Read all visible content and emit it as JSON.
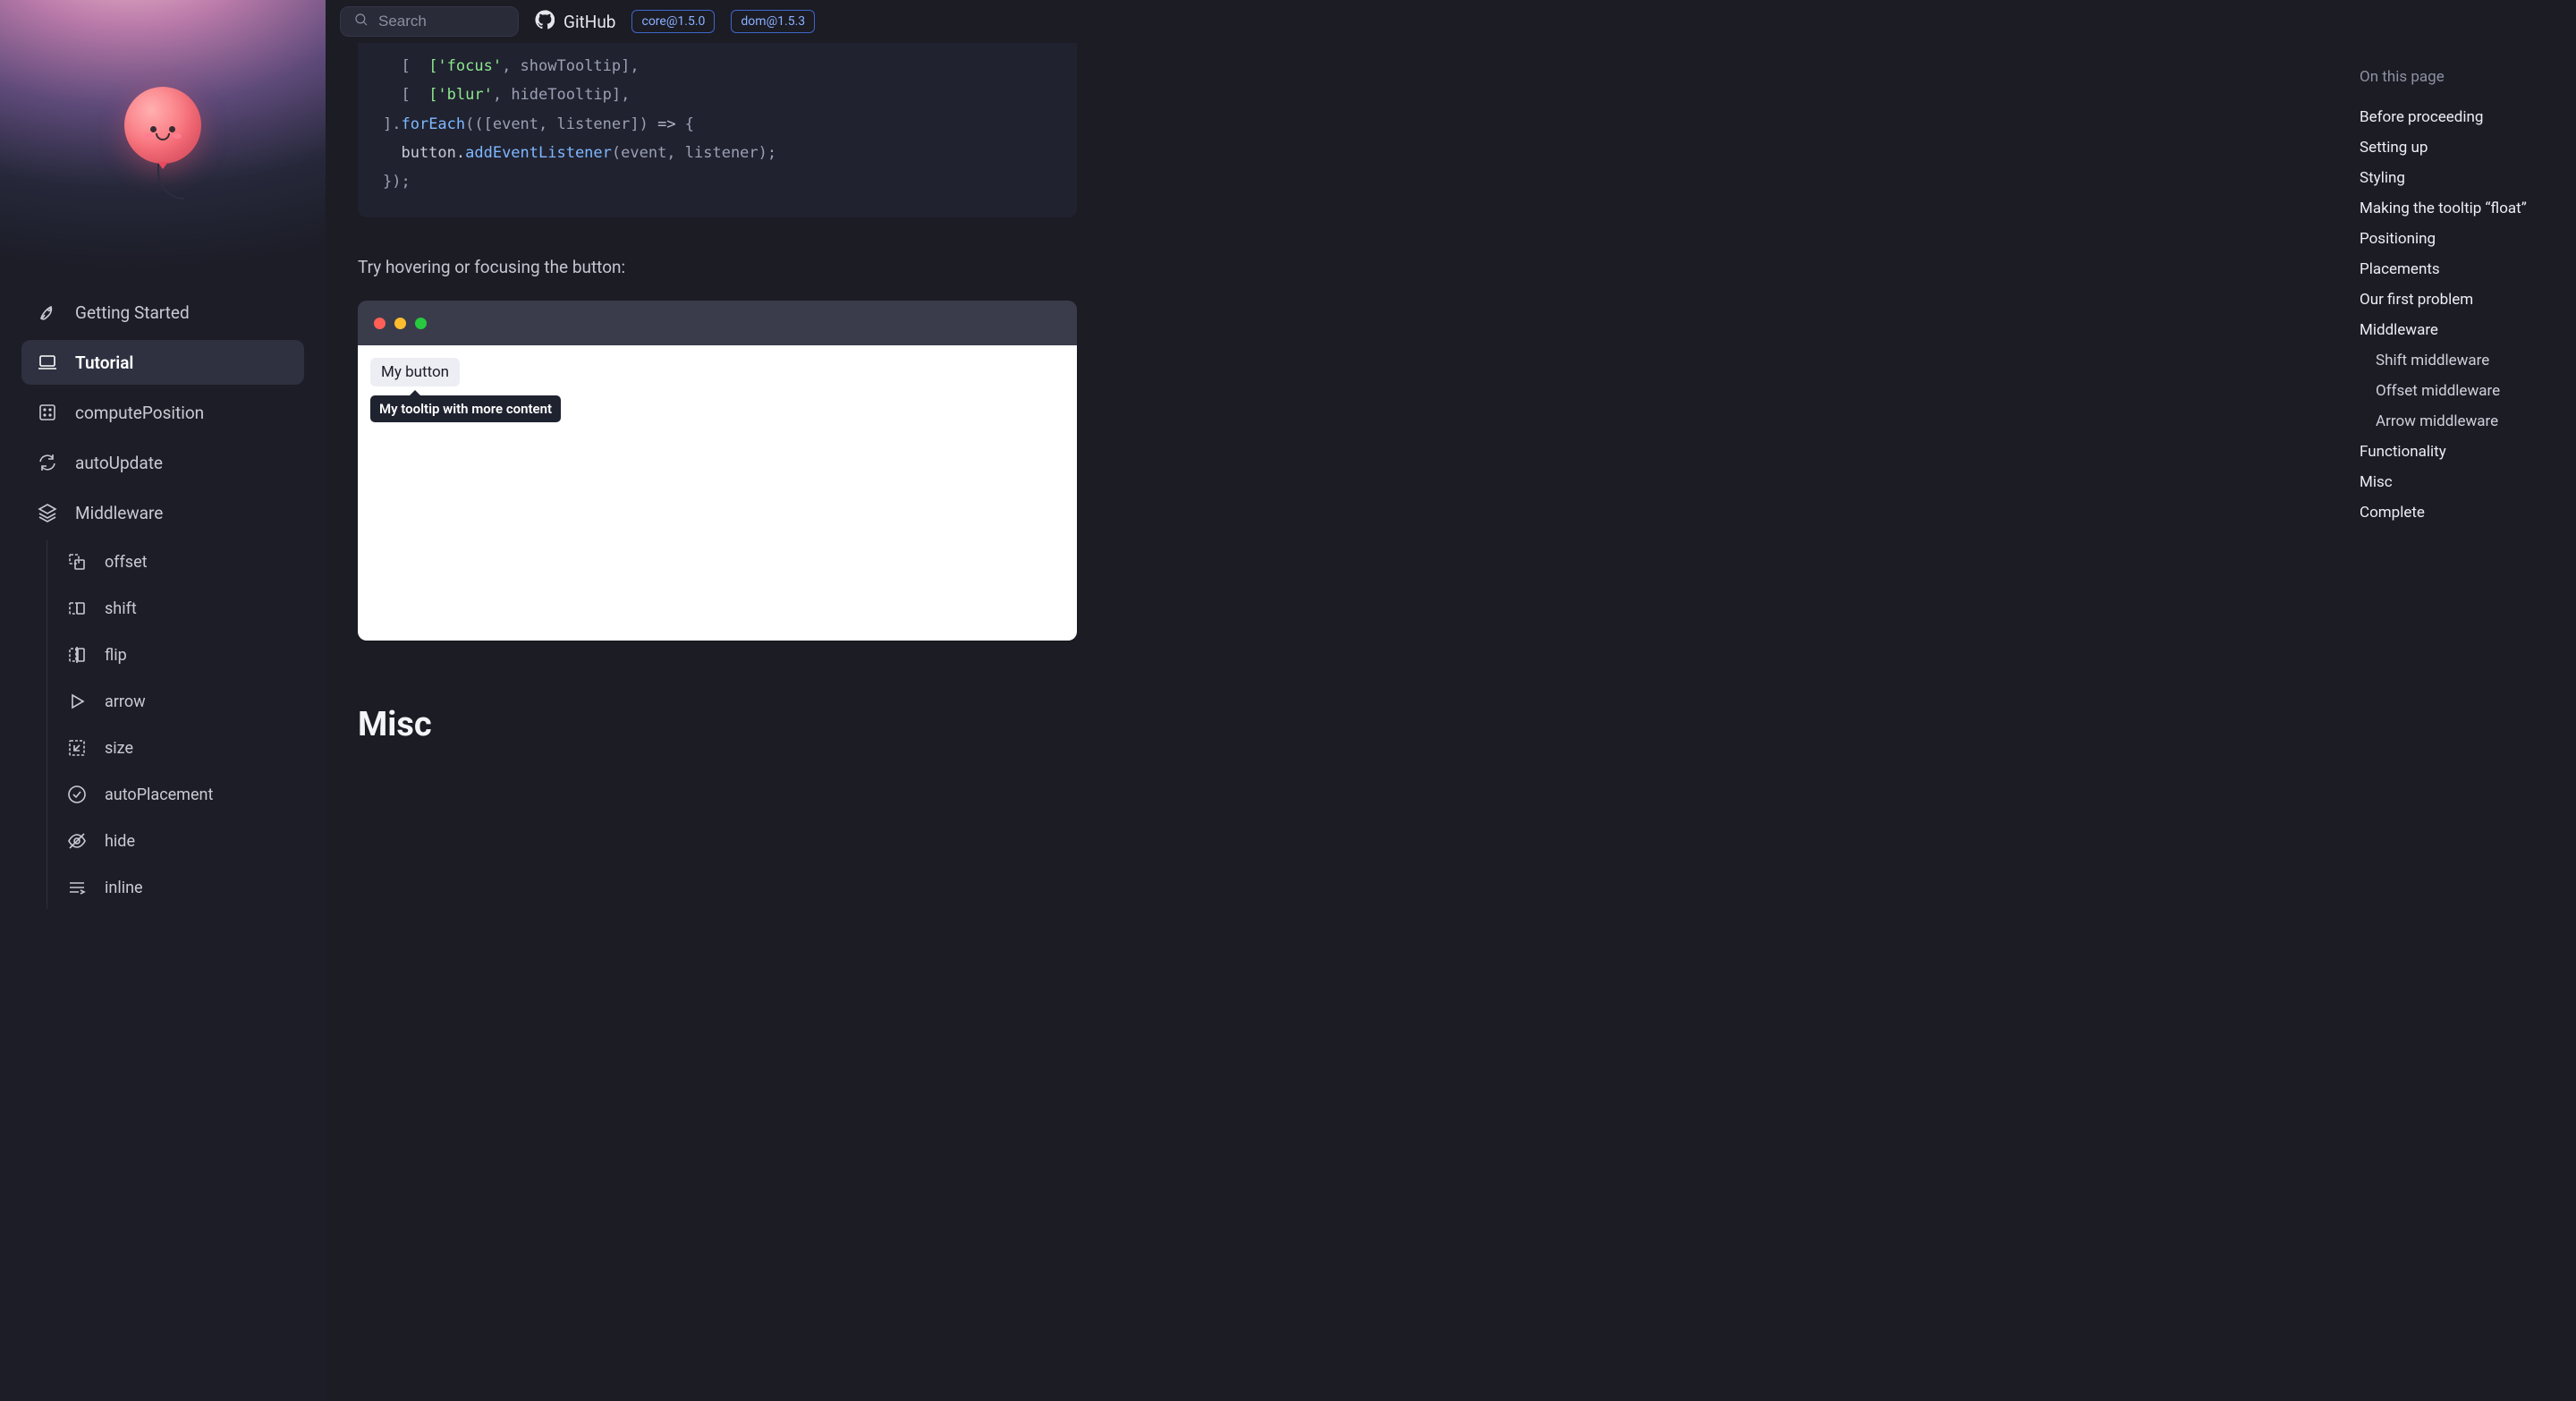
{
  "topbar": {
    "search_placeholder": "Search",
    "github_label": "GitHub",
    "badges": [
      "core@1.5.0",
      "dom@1.5.3"
    ]
  },
  "sidebar": {
    "items": [
      {
        "label": "Getting Started",
        "icon": "rocket-icon"
      },
      {
        "label": "Tutorial",
        "icon": "laptop-icon",
        "active": true
      },
      {
        "label": "computePosition",
        "icon": "grid-icon"
      },
      {
        "label": "autoUpdate",
        "icon": "refresh-icon"
      },
      {
        "label": "Middleware",
        "icon": "layers-icon"
      }
    ],
    "middleware_children": [
      {
        "label": "offset",
        "icon": "offset-icon"
      },
      {
        "label": "shift",
        "icon": "shift-icon"
      },
      {
        "label": "flip",
        "icon": "flip-icon"
      },
      {
        "label": "arrow",
        "icon": "play-icon"
      },
      {
        "label": "size",
        "icon": "size-icon"
      },
      {
        "label": "autoPlacement",
        "icon": "check-circle-icon"
      },
      {
        "label": "hide",
        "icon": "eye-off-icon"
      },
      {
        "label": "inline",
        "icon": "inline-icon"
      }
    ]
  },
  "code": {
    "line1_a": "  ['focus'",
    "line1_b": ", showTooltip],",
    "line2_a": "  ['blur'",
    "line2_b": ", hideTooltip],",
    "line3_a": "].",
    "line3_fn": "forEach",
    "line3_b": "(([event, listener]) ",
    "line3_arrow": "=>",
    "line3_c": " {",
    "line4_a": "  button.",
    "line4_fn": "addEventListener",
    "line4_b": "(event, listener);",
    "line5": "});"
  },
  "article": {
    "lead": "Try hovering or focusing the button:",
    "demo_button": "My button",
    "demo_tooltip": "My tooltip with more content",
    "misc_heading": "Misc"
  },
  "toc": {
    "title": "On this page",
    "items": [
      "Before proceeding",
      "Setting up",
      "Styling",
      "Making the tooltip “float”",
      "Positioning",
      "Placements",
      "Our first problem",
      "Middleware"
    ],
    "middleware_sub": [
      "Shift middleware",
      "Offset middleware",
      "Arrow middleware"
    ],
    "items_after": [
      "Functionality",
      "Misc",
      "Complete"
    ]
  }
}
